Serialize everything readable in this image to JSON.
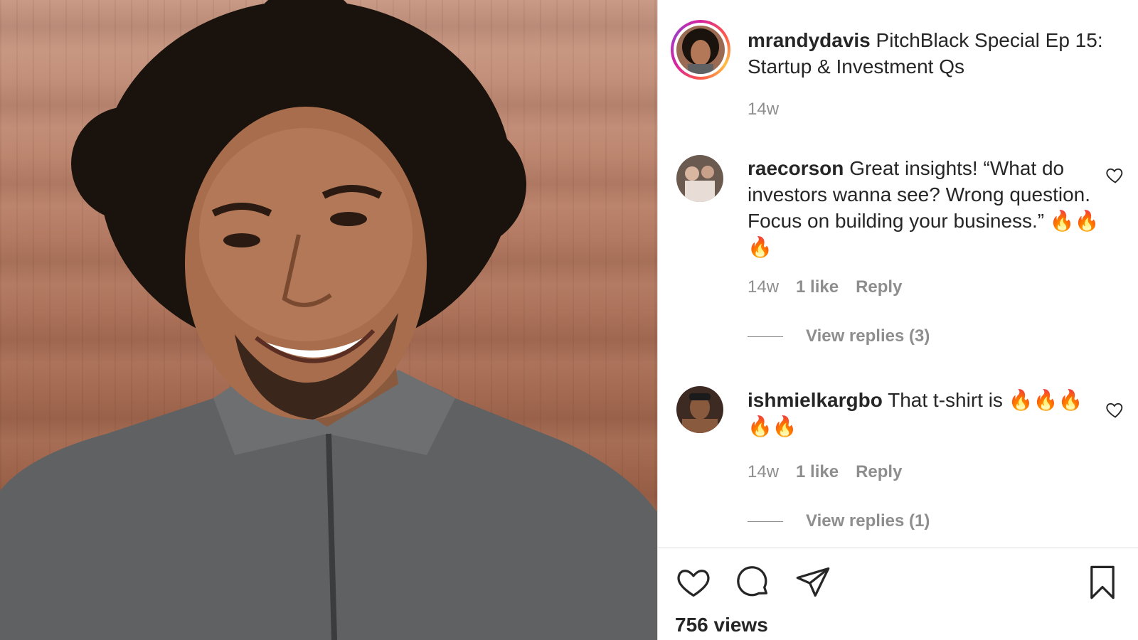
{
  "post": {
    "username": "mrandydavis",
    "caption": "PitchBlack Special Ep 15: Startup & Investment Qs",
    "time": "14w",
    "views": "756 views"
  },
  "comments": [
    {
      "username": "raecorson",
      "text": "Great insights! “What do investors wanna see? Wrong question. Focus on building your business.” 🔥🔥🔥",
      "time": "14w",
      "likes": "1 like",
      "reply_label": "Reply",
      "view_replies": "View replies (3)"
    },
    {
      "username": "ishmielkargbo",
      "text": "That t-shirt is 🔥🔥🔥🔥🔥",
      "time": "14w",
      "likes": "1 like",
      "reply_label": "Reply",
      "view_replies": "View replies (1)"
    }
  ],
  "icons": {
    "like": "heart-icon",
    "comment": "comment-bubble-icon",
    "share": "paper-plane-icon",
    "save": "bookmark-icon"
  },
  "colors": {
    "text": "#262626",
    "muted": "#8e8e8e",
    "divider": "#dbdbdb"
  }
}
